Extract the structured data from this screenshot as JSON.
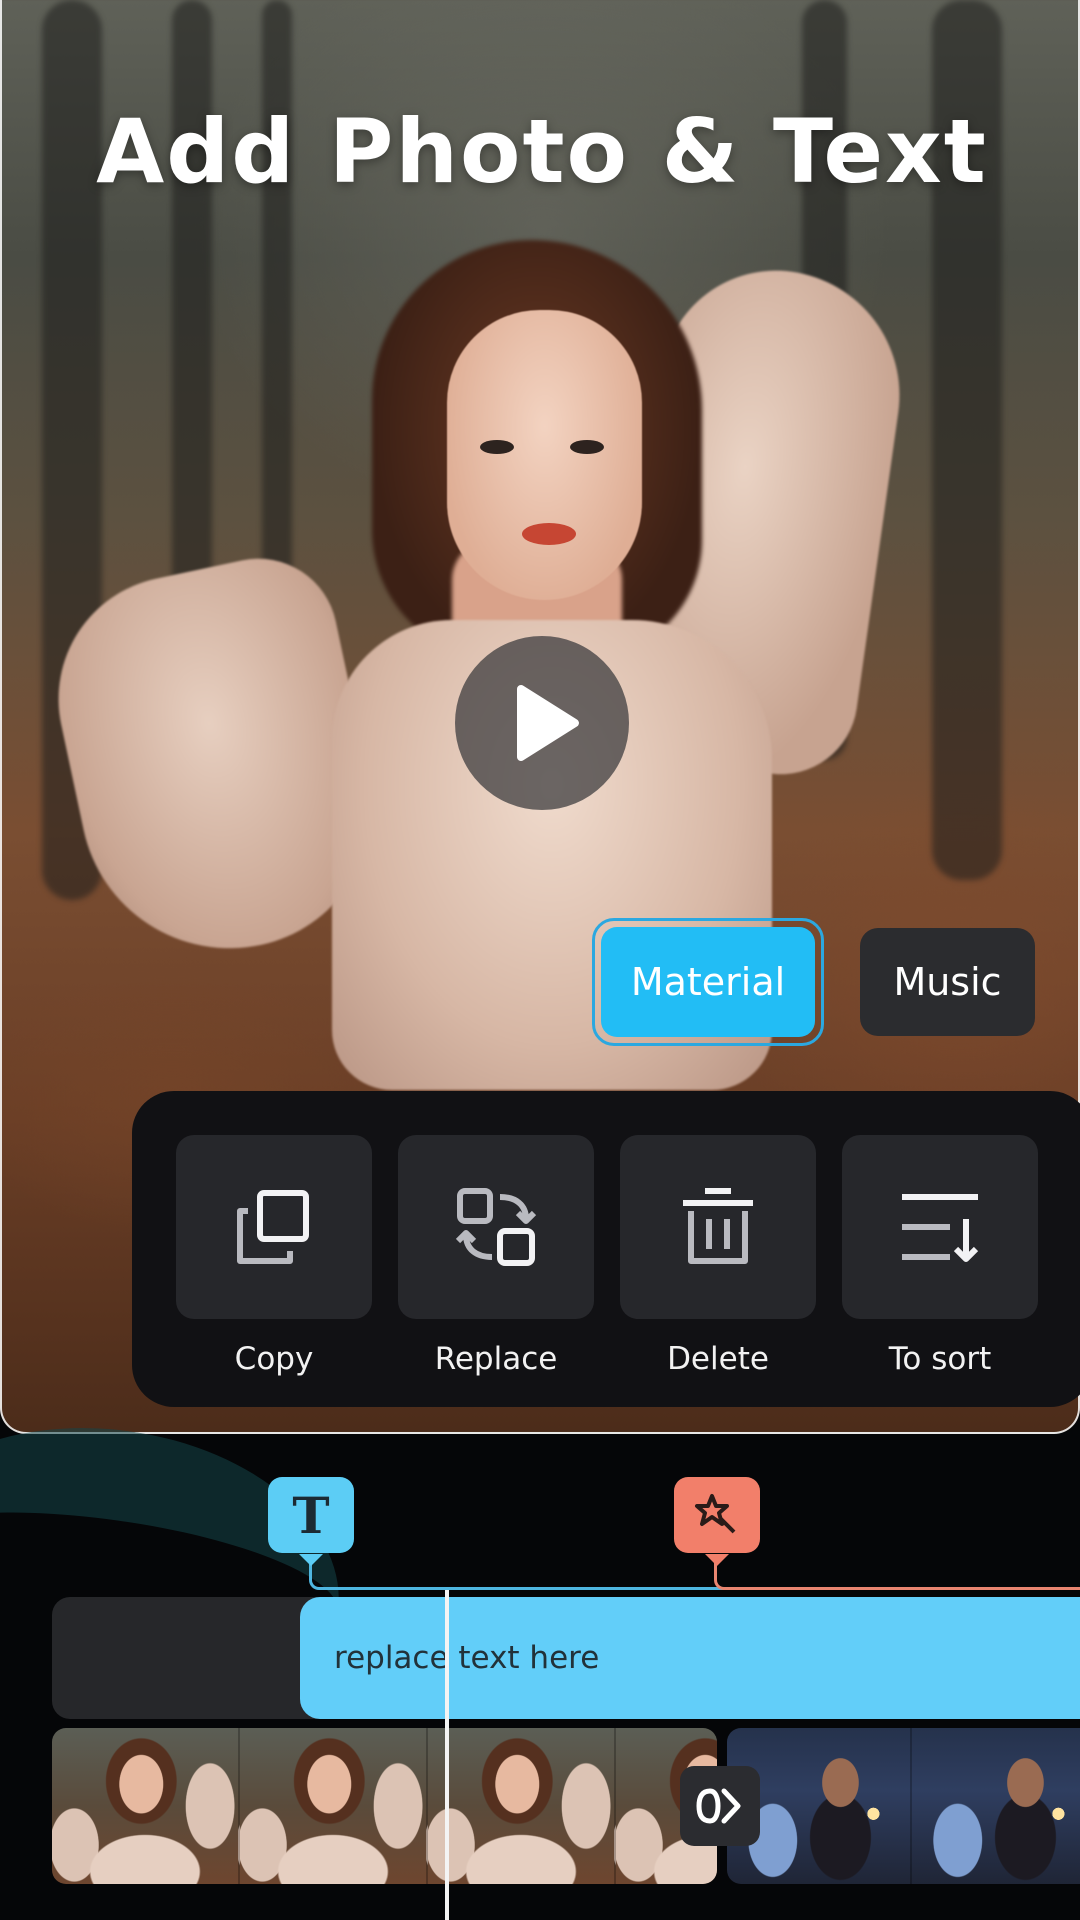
{
  "hero": {
    "title": "Add Photo & Text",
    "play_icon": "play-icon"
  },
  "tabs": [
    {
      "label": "Material",
      "selected": true
    },
    {
      "label": "Music",
      "selected": false
    }
  ],
  "actions": [
    {
      "label": "Copy",
      "icon": "copy-icon"
    },
    {
      "label": "Replace",
      "icon": "replace-icon"
    },
    {
      "label": "Delete",
      "icon": "trash-icon"
    },
    {
      "label": "To sort",
      "icon": "sort-icon"
    }
  ],
  "timeline": {
    "text_marker_glyph": "T",
    "effect_marker_icon": "sparkle-effect-icon",
    "text_clip": "replace text here",
    "transition_icon": "transition-icon"
  },
  "colors": {
    "accent_blue": "#22bdf5",
    "text_clip": "#62cef9",
    "effect_marker": "#f27f6a",
    "panel": "#111114",
    "tile": "#26272b"
  }
}
